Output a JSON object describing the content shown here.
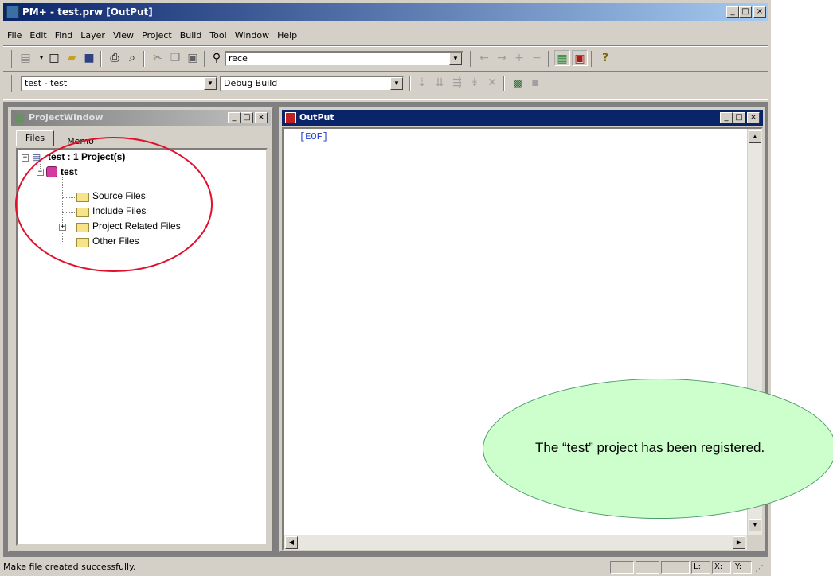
{
  "window": {
    "title": "PM+ - test.prw [OutPut]",
    "minimize_icon": "minimize-icon",
    "maximize_icon": "maximize-icon",
    "close_icon": "close-icon"
  },
  "menu": [
    "File",
    "Edit",
    "Find",
    "Layer",
    "View",
    "Project",
    "Build",
    "Tool",
    "Window",
    "Help"
  ],
  "toolbar1": {
    "search_value": "rece"
  },
  "toolbar2": {
    "project_select": "test - test",
    "build_select": "Debug Build"
  },
  "project_window": {
    "title": "ProjectWindow",
    "tabs": [
      "Files",
      "Memo"
    ],
    "tree": {
      "root": "test : 1 Project(s)",
      "project": "test",
      "folders": [
        "Source Files",
        "Include Files",
        "Project Related Files",
        "Other Files"
      ]
    }
  },
  "output_window": {
    "title": "OutPut",
    "line_marker": "–",
    "content": "[EOF]"
  },
  "statusbar": {
    "message": "Make file created successfully.",
    "line_label": "L:",
    "x_label": "X:",
    "y_label": "Y:"
  },
  "callout": {
    "text": "The “test” project has been registered."
  },
  "colors": {
    "title_active": "#0a246a",
    "callout_fill": "#ccffcc",
    "callout_border": "#4d9a6a",
    "highlight_ellipse": "#e0102a",
    "eof_text": "#1a3acd"
  }
}
